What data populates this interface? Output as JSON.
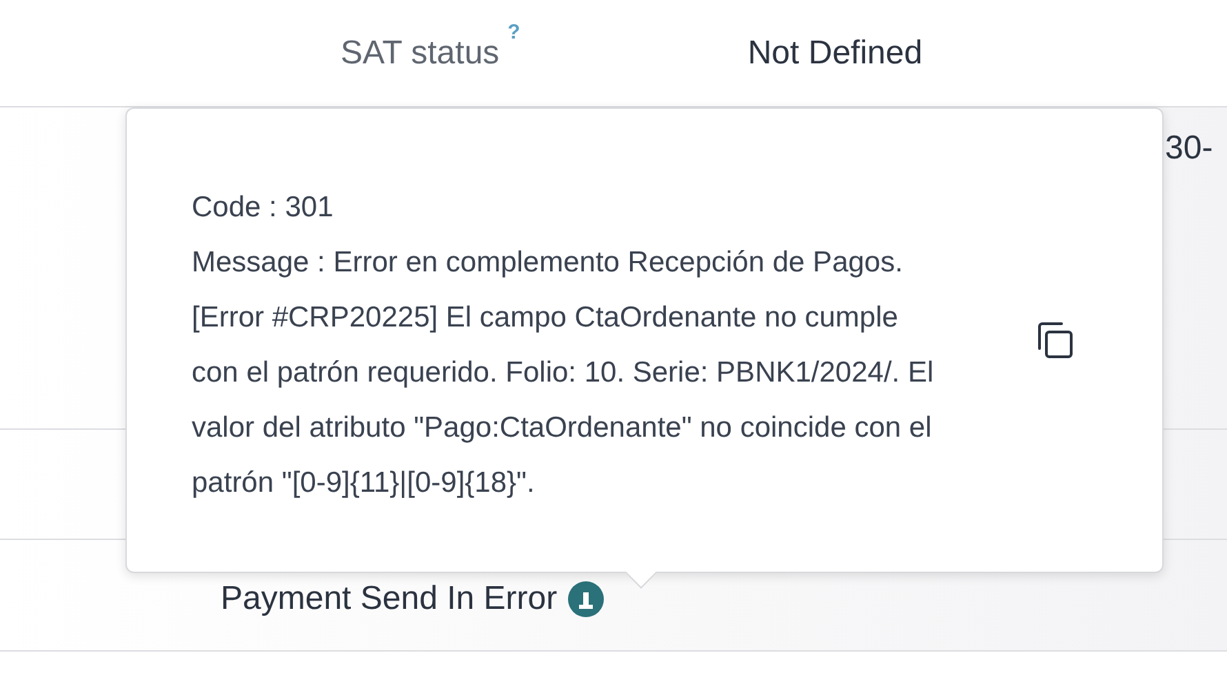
{
  "field": {
    "label": "SAT status",
    "help": "?",
    "value": "Not Defined"
  },
  "cut_value": "30-",
  "status": {
    "label": "Payment Send In Error"
  },
  "tooltip": {
    "code": "Code : 301",
    "message": "Message : Error en complemento Recepción de Pagos. [Error #CRP20225] El campo CtaOrdenante no cumple con el patrón requerido. Folio: 10. Serie: PBNK1/2024/. El valor del atributo \"Pago:CtaOrdenante\" no coincide con el patrón \"[0-9]{11}|[0-9]{18}\"."
  }
}
